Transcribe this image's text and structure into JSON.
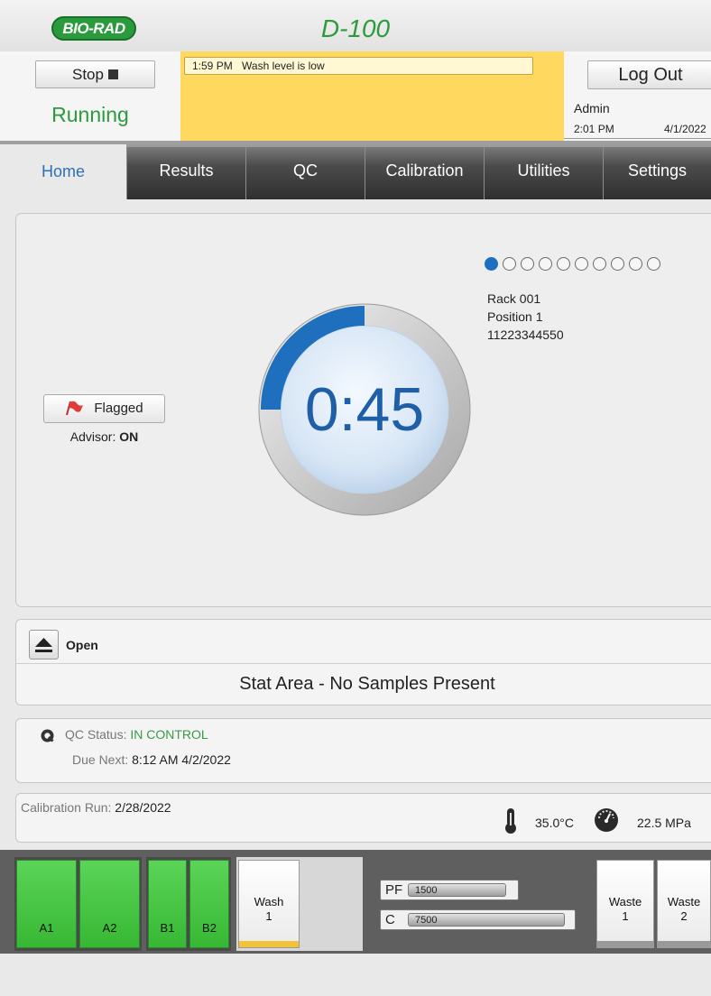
{
  "header": {
    "logo": "BIO-RAD",
    "title": "D-100"
  },
  "status": {
    "stop_label": "Stop",
    "state": "Running",
    "alert": {
      "time": "1:59 PM",
      "message": "Wash level is low"
    },
    "logout_label": "Log Out",
    "user": "Admin",
    "time": "2:01 PM",
    "date": "4/1/2022"
  },
  "tabs": [
    {
      "label": "Home",
      "active": true
    },
    {
      "label": "Results"
    },
    {
      "label": "QC"
    },
    {
      "label": "Calibration"
    },
    {
      "label": "Utilities"
    },
    {
      "label": "Settings"
    }
  ],
  "main": {
    "flag_button": "Flagged",
    "advisor_label": "Advisor:",
    "advisor_value": "ON",
    "position_indicator": {
      "total": 10,
      "active_index": 0
    },
    "sample": {
      "rack": "Rack 001",
      "position": "Position 1",
      "id": "11223344550"
    },
    "timer": {
      "display": "0:45",
      "progress_fraction": 0.25
    }
  },
  "stat": {
    "open_label": "Open",
    "message": "Stat Area - No Samples Present"
  },
  "qc": {
    "status_label": "QC Status:",
    "status_value": "IN CONTROL",
    "due_label": "Due Next:",
    "due_value": "8:12 AM 4/2/2022"
  },
  "calibration": {
    "run_label": "Calibration Run:",
    "run_value": "2/28/2022",
    "temperature": "35.0°C",
    "pressure": "22.5 MPa"
  },
  "reagents": {
    "racks": [
      "A1",
      "A2",
      "B1",
      "B2"
    ],
    "wash": {
      "name": "Wash",
      "number": "1"
    },
    "levels": [
      {
        "name": "PF",
        "value": "1500"
      },
      {
        "name": "C",
        "value": "7500"
      }
    ],
    "waste": [
      {
        "name": "Waste",
        "number": "1"
      },
      {
        "name": "Waste",
        "number": "2"
      }
    ]
  },
  "colors": {
    "accent_green": "#2d9a3d",
    "alert_yellow": "#ffd95f",
    "tab_active_text": "#2f6fb2",
    "timer_blue": "#1f6fbf"
  }
}
